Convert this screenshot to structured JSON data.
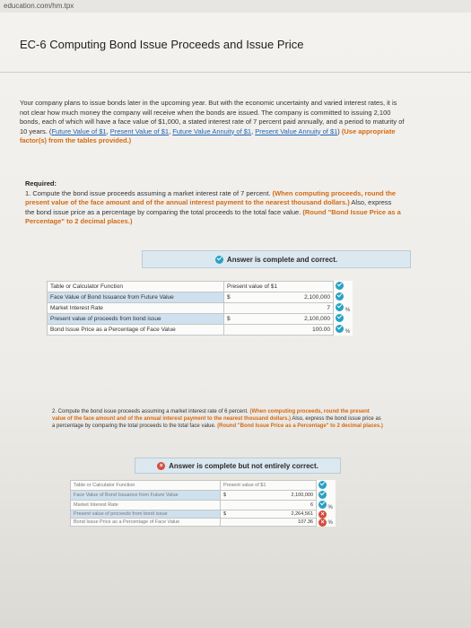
{
  "url": "education.com/hm.tpx",
  "title": "EC-6 Computing Bond Issue Proceeds and Issue Price",
  "intro": {
    "text": "Your company plans to issue bonds later in the upcoming year. But with the economic uncertainty and varied interest rates, it is not clear how much money the company will receive when the bonds are issued. The company is committed to issuing 2,100 bonds, each of which will have a face value of $1,000, a stated interest rate of 7 percent paid annually, and a period to maturity of 10 years. (",
    "links": [
      "Future Value of $1",
      "Present Value of $1",
      "Future Value Annuity of $1",
      "Present Value Annuity of $1"
    ],
    "instruction": "(Use appropriate factor(s) from the tables provided.)"
  },
  "required": {
    "heading": "Required:",
    "q1_text": "1. Compute the bond issue proceeds assuming a market interest rate of 7 percent.",
    "q1_instr": "(When computing proceeds, round the present value of the face amount and of the annual interest payment to the nearest thousand dollars.)",
    "q1_tail": "Also, express the bond issue price as a percentage by comparing the total proceeds to the total face value.",
    "q1_round": "(Round \"Bond Issue Price as a Percentage\" to 2 decimal places.)"
  },
  "answer1": {
    "label": "Answer is complete and correct."
  },
  "table1": {
    "col1": "Table or Calculator Function",
    "col2": "Present value of $1",
    "rows": [
      {
        "label": "Face Value of Bond Issuance from Future Value",
        "prefix": "$",
        "value": "2,100,000",
        "unit": ""
      },
      {
        "label": "Market Interest Rate",
        "prefix": "",
        "value": "7",
        "unit": "%"
      },
      {
        "label": "Present value of proceeds from bond issue",
        "prefix": "$",
        "value": "2,100,000",
        "unit": ""
      },
      {
        "label": "Bond Issue Price as a Percentage of Face Value",
        "prefix": "",
        "value": "100.00",
        "unit": "%"
      }
    ]
  },
  "q2": {
    "text": "2. Compute the bond issue proceeds assuming a market interest rate of 6 percent.",
    "instr": "(When computing proceeds, round the present value of the face amount and of the annual interest payment to the nearest thousand dollars.)",
    "tail": "Also, express the bond issue price as a percentage by comparing the total proceeds to the total face value.",
    "round": "(Round \"Bond Issue Price as a Percentage\" to 2 decimal places.)"
  },
  "answer2": {
    "label": "Answer is complete but not entirely correct."
  },
  "table2": {
    "col1": "Table or Calculator Function",
    "col2": "Present value of $1",
    "rows": [
      {
        "label": "Face Value of Bond Issuance from Future Value",
        "prefix": "$",
        "value": "2,100,000",
        "unit": ""
      },
      {
        "label": "Market Interest Rate",
        "prefix": "",
        "value": "6",
        "unit": "%"
      },
      {
        "label": "Present value of proceeds from bond issue",
        "prefix": "$",
        "value": "2,264,561",
        "unit": ""
      },
      {
        "label": "Bond Issue Price as a Percentage of Face Value",
        "prefix": "",
        "value": "107.36",
        "unit": "%"
      }
    ]
  }
}
